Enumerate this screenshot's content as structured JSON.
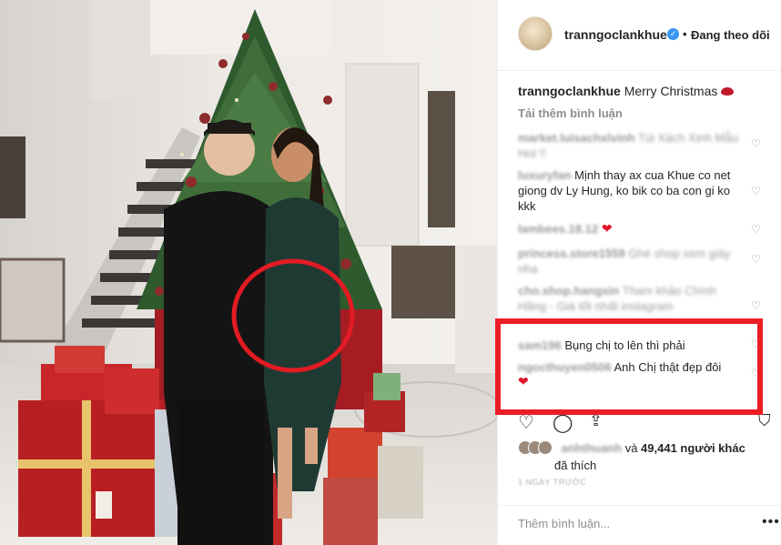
{
  "post": {
    "username": "tranngoclankhue",
    "verified_icon": "verified-badge-icon",
    "separator": "•",
    "follow_status": "Đang theo dõi",
    "caption_user": "tranngoclankhue",
    "caption_text": "Merry Christmas",
    "load_more": "Tải thêm bình luận"
  },
  "comments": [
    {
      "user": "market.luisachxlvinh",
      "text": "Túi Xách Xinh Mẫu Hot !!"
    },
    {
      "user": "luxuryfan",
      "text": "Mịnh thay ax cua Khue co net giong dv Ly Hung, ko bik co ba con gi ko kkk"
    },
    {
      "user": "lambees.18.12",
      "text": "❤"
    },
    {
      "user": "princess.store1559",
      "text": "Ghé shop xem giày nha"
    },
    {
      "user": "cho.shop.hangxin",
      "text": "Tham khảo Chính Hãng - Giá tốt nhất instagram"
    },
    {
      "user": "sam196",
      "text": "Bụng chị to lên thì phải"
    },
    {
      "user": "ngocthuyen0506",
      "text": "Anh Chị thật đẹp đôi"
    },
    {
      "user": "",
      "text": "❤"
    }
  ],
  "likes": {
    "user": "anhthuanh",
    "connector": "và",
    "count_text": "49,441 người khác",
    "suffix": "đã thích"
  },
  "timestamp": "1 NGÀY TRƯỚC",
  "add_comment_placeholder": "Thêm bình luận...",
  "more_options": "•••",
  "colors": {
    "highlight": "#ec1c24",
    "verified": "#3897f0",
    "heart": "#e0172b"
  }
}
